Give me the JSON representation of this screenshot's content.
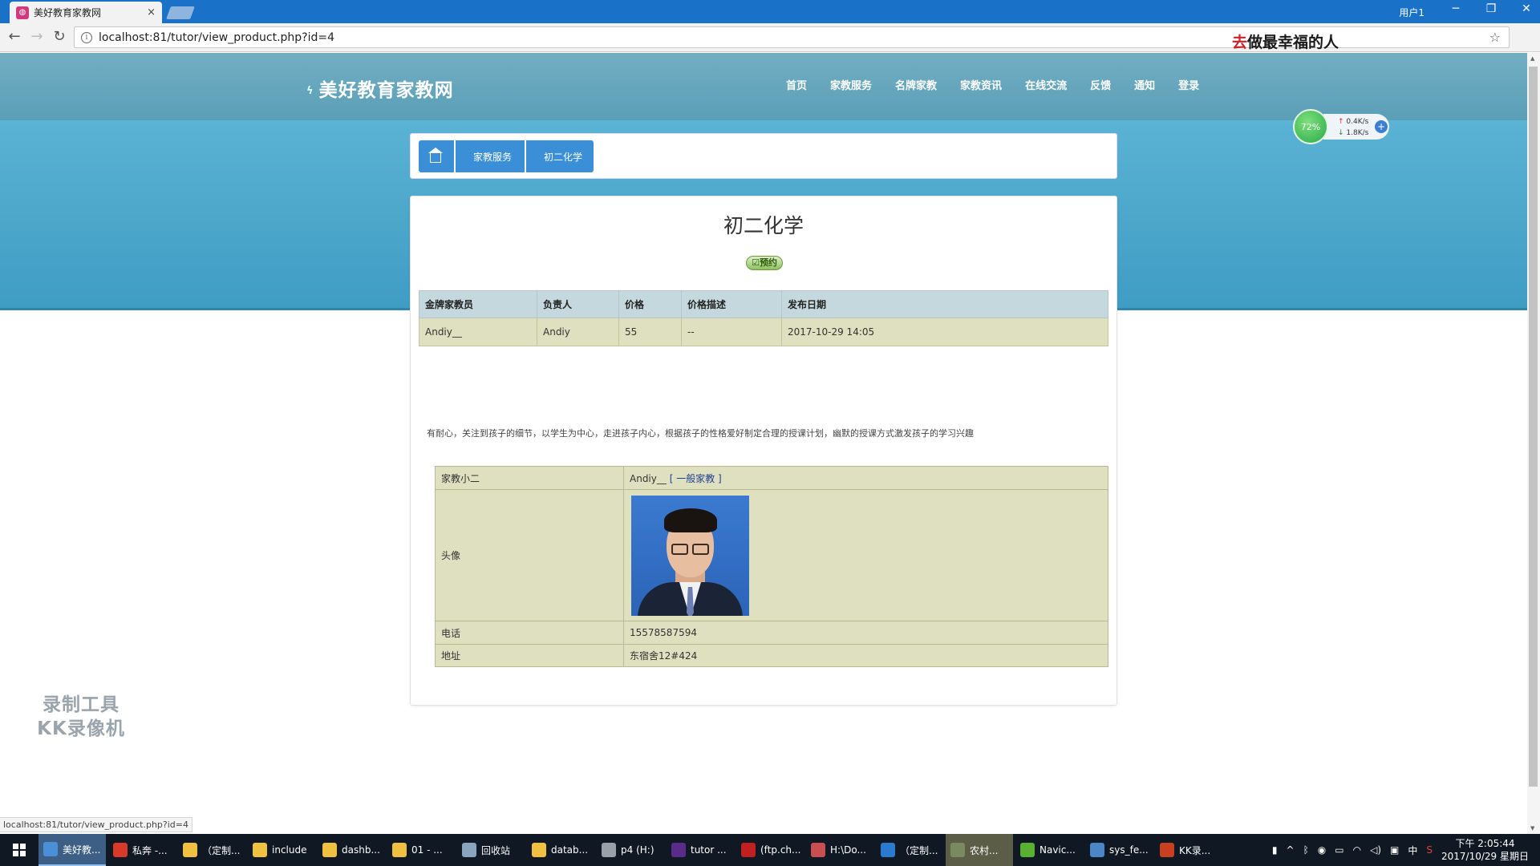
{
  "browser": {
    "tab_title": "美好教育家教网",
    "tab_close": "×",
    "window_user": "用户1",
    "win_min": "─",
    "win_max": "❐",
    "win_close": "✕",
    "url": "localhost:81/tutor/view_product.php?id=4",
    "slogan_highlight": "去",
    "slogan_rest": "做最幸福的人",
    "status_url": "localhost:81/tutor/view_product.php?id=4"
  },
  "site": {
    "logo": "美好教育家教网",
    "nav": [
      "首页",
      "家教服务",
      "名牌家教",
      "家教资讯",
      "在线交流",
      "反馈",
      "通知",
      "登录"
    ]
  },
  "net_widget": {
    "percent": "72%",
    "up": "0.4K/s",
    "down": "1.8K/s"
  },
  "breadcrumb": {
    "items": [
      "家教服务",
      "初二化学"
    ]
  },
  "product": {
    "title": "初二化学",
    "reserve_label": "预约",
    "table_headers": [
      "金牌家教员",
      "负责人",
      "价格",
      "价格描述",
      "发布日期"
    ],
    "table_row": [
      "Andiy__",
      "Andiy",
      "55",
      "--",
      "2017-10-29 14:05"
    ],
    "description": "有耐心，关注到孩子的细节，以学生为中心，走进孩子内心，根据孩子的性格爱好制定合理的授课计划，幽默的授课方式激发孩子的学习兴趣"
  },
  "tutor": {
    "name_label": "家教小二",
    "name_value": "Andiy__",
    "rank": "[ 一般家教 ]",
    "avatar_label": "头像",
    "phone_label": "电话",
    "phone_value": "15578587594",
    "address_label": "地址",
    "address_value": "东宿舍12#424"
  },
  "watermark": {
    "line1": "录制工具",
    "line2": "KK录像机"
  },
  "taskbar": {
    "items": [
      {
        "label": "美好教...",
        "color": "#4a8fd8"
      },
      {
        "label": "私奔 -...",
        "color": "#d83a2a"
      },
      {
        "label": "（定制...",
        "color": "#f0c040"
      },
      {
        "label": "include",
        "color": "#f0c040"
      },
      {
        "label": "dashb...",
        "color": "#f0c040"
      },
      {
        "label": "01 - ...",
        "color": "#f0c040"
      },
      {
        "label": "回收站",
        "color": "#8aa4c0"
      },
      {
        "label": "datab...",
        "color": "#f0c040"
      },
      {
        "label": "p4 (H:)",
        "color": "#9aa0a8"
      },
      {
        "label": "tutor ...",
        "color": "#5a2c8a"
      },
      {
        "label": "(ftp.ch...",
        "color": "#c02020"
      },
      {
        "label": "H:\\Do...",
        "color": "#c85050"
      },
      {
        "label": "（定制...",
        "color": "#2a7ad0"
      },
      {
        "label": "农村...",
        "color": "#7a8a60"
      },
      {
        "label": "Navic...",
        "color": "#5ab030"
      },
      {
        "label": "sys_fe...",
        "color": "#4a86c8"
      },
      {
        "label": "KK录...",
        "color": "#c84020"
      }
    ],
    "ime": "中",
    "time": "下午 2:05:44",
    "date": "2017/10/29 星期日"
  }
}
